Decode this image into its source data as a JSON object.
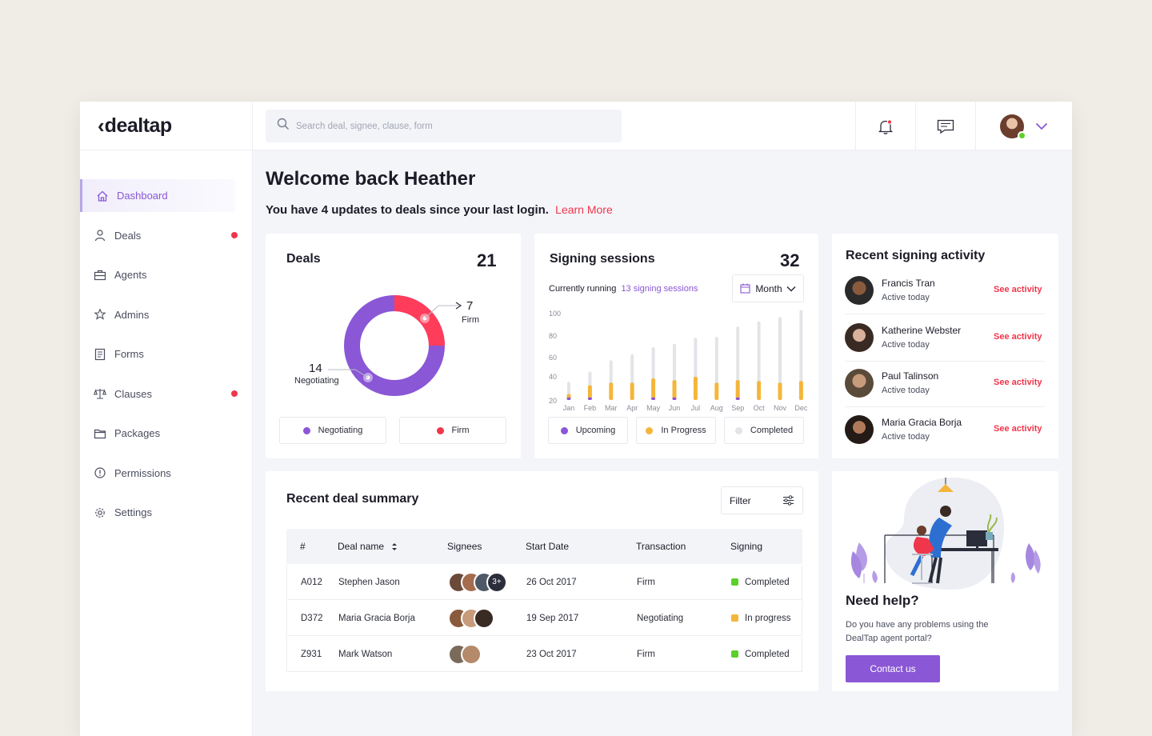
{
  "brand": {
    "logo_mark": "‹",
    "logo_text": "dealtap"
  },
  "search": {
    "placeholder": "Search deal, signee, clause, form"
  },
  "nav": {
    "dashboard": "Dashboard",
    "deals": "Deals",
    "agents": "Agents",
    "admins": "Admins",
    "forms": "Forms",
    "clauses": "Clauses",
    "packages": "Packages",
    "permissions": "Permissions",
    "settings": "Settings"
  },
  "header": {
    "welcome": "Welcome back Heather",
    "updates": "You have 4 updates to deals since your last login.",
    "learn_more": "Learn More"
  },
  "deals_card": {
    "title": "Deals",
    "count": "21",
    "firm_value": "7",
    "firm_label": "Firm",
    "negotiating_value": "14",
    "negotiating_label": "Negotiating",
    "legend_negotiating": "Negotiating",
    "legend_firm": "Firm"
  },
  "sessions_card": {
    "title": "Signing sessions",
    "count": "32",
    "running_prefix": "Currently running",
    "running_link": "13 signing sessions",
    "period": "Month",
    "legend_upcoming": "Upcoming",
    "legend_inprogress": "In Progress",
    "legend_completed": "Completed"
  },
  "chart_data": {
    "type": "bar",
    "categories": [
      "Jan",
      "Feb",
      "Mar",
      "Apr",
      "May",
      "Jun",
      "Jul",
      "Aug",
      "Sep",
      "Oct",
      "Nov",
      "Dec"
    ],
    "yticks": [
      100,
      80,
      60,
      40,
      20
    ],
    "ylim": [
      0,
      100
    ],
    "series": [
      {
        "name": "Upcoming",
        "values": [
          3,
          3,
          0,
          0,
          3,
          3,
          0,
          0,
          3,
          0,
          0,
          0
        ]
      },
      {
        "name": "In Progress",
        "values": [
          4,
          14,
          20,
          20,
          22,
          20,
          27,
          20,
          20,
          22,
          20,
          22
        ]
      },
      {
        "name": "Completed",
        "values": [
          14,
          16,
          26,
          33,
          36,
          42,
          45,
          53,
          62,
          69,
          76,
          82
        ]
      }
    ],
    "colors": {
      "upcoming": "#8a57d6",
      "in_progress": "#f4b63a",
      "completed": "#e3e4e8"
    }
  },
  "activity": {
    "title": "Recent signing activity",
    "items": [
      {
        "name": "Francis Tran",
        "status": "Active today",
        "link": "See activity"
      },
      {
        "name": "Katherine Webster",
        "status": "Active today",
        "link": "See activity"
      },
      {
        "name": "Paul Talinson",
        "status": "Active today",
        "link": "See activity"
      },
      {
        "name": "Maria Gracia Borja",
        "status": "Active today",
        "link": "See activity"
      }
    ]
  },
  "summary": {
    "title": "Recent deal summary",
    "filter": "Filter",
    "columns": [
      "#",
      "Deal name",
      "Signees",
      "Start Date",
      "Transaction",
      "Signing"
    ],
    "rows": [
      {
        "id": "A012",
        "name": "Stephen Jason",
        "more": "3+",
        "date": "26 Oct 2017",
        "transaction": "Firm",
        "signing": "Completed"
      },
      {
        "id": "D372",
        "name": "Maria Gracia Borja",
        "more": "",
        "date": "19 Sep 2017",
        "transaction": "Negotiating",
        "signing": "In progress"
      },
      {
        "id": "Z931",
        "name": "Mark Watson",
        "more": "",
        "date": "23 Oct 2017",
        "transaction": "Firm",
        "signing": "Completed"
      }
    ]
  },
  "help": {
    "title": "Need help?",
    "text1": "Do you have any problems using the",
    "text2": "DealTap agent portal?",
    "button": "Contact us"
  },
  "colors": {
    "accent": "#8a57d6",
    "red": "#f0364a",
    "yellow": "#f4b63a",
    "green": "#5bd02b"
  }
}
